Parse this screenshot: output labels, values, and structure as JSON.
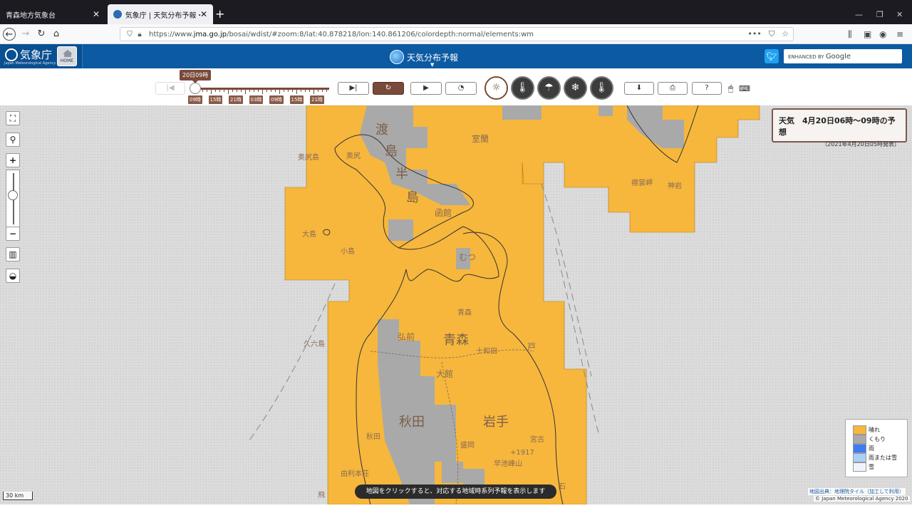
{
  "browser": {
    "tabs": [
      {
        "title": "青森地方気象台",
        "active": false
      },
      {
        "title": "気象庁 | 天気分布予報・地域時",
        "active": true
      }
    ],
    "url_prefix": "https://www.",
    "url_domain": "jma.go.jp",
    "url_path": "/bosai/wdist/#zoom:8/lat:40.878218/lon:140.861206/colordepth:normal/elements:wm"
  },
  "header": {
    "agency_name": "気象庁",
    "agency_sub": "Japan Meteorological Agency",
    "home_label": "HOME",
    "page_title": "天気分布予報",
    "search_prefix": "ENHANCED BY",
    "search_brand": "Google"
  },
  "toolbar": {
    "current_time": "20日09時",
    "time_ticks": [
      "09時",
      "15時",
      "21時",
      "03時",
      "09時",
      "15時",
      "21時"
    ]
  },
  "map": {
    "info_title": "天気　4月20日06時～09時の予想",
    "info_issued": "（2021年4月20日05時発表）",
    "legend": [
      {
        "label": "晴れ",
        "color": "#f6b73c"
      },
      {
        "label": "くもり",
        "color": "#aaaaaa"
      },
      {
        "label": "雨",
        "color": "#3d7cf5"
      },
      {
        "label": "雨または雪",
        "color": "#a9d1f7"
      },
      {
        "label": "雪",
        "color": "#f1f3fb"
      }
    ],
    "scale": "30 km",
    "hint": "地図をクリックすると、対応する地域時系列予報を表示します",
    "credit_tiles": "地図出典：地理院タイル（加工して利用）",
    "credit_jma": "© Japan Meteorological Agency 2020",
    "labels": {
      "oshima": "渡",
      "oshima2": "島",
      "hanto1": "半",
      "hanto2": "島",
      "hakodate": "函館",
      "muroran": "室蘭",
      "okushiri": "奥尻島",
      "okushiri2": "奥尻",
      "oshima_is": "大島",
      "koshima": "小島",
      "mutsu": "むつ",
      "aomori": "青森",
      "aomori_city": "青森",
      "hirosaki": "弘前",
      "towada": "十和田",
      "hachinohe": "戸",
      "odate": "大館",
      "akita": "秋田",
      "akita_city": "秋田",
      "iwate": "岩手",
      "morioka": "盛岡",
      "miyako": "宮古",
      "yurihonjo": "由利本荘",
      "kuroishi": "石",
      "kurokuroshima": "久六島",
      "erimo": "襟裳岬",
      "kamaishi": "神岩",
      "hayachine": "早池峰山",
      "hayachine_alt": "+1917",
      "tobi": "飛"
    }
  }
}
